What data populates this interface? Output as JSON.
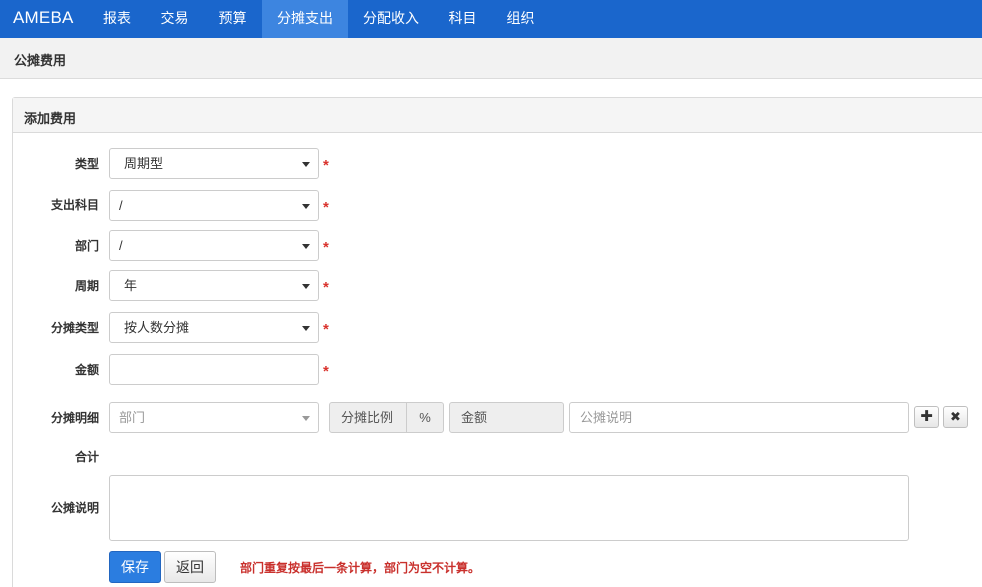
{
  "nav": {
    "brand": "AMEBA",
    "items": [
      {
        "label": "报表"
      },
      {
        "label": "交易"
      },
      {
        "label": "预算"
      },
      {
        "label": "分摊支出",
        "active": true
      },
      {
        "label": "分配收入"
      },
      {
        "label": "科目"
      },
      {
        "label": "组织"
      }
    ]
  },
  "subheader": {
    "title": "公摊费用"
  },
  "panel": {
    "title": "添加费用"
  },
  "form": {
    "type": {
      "label": "类型",
      "value": "周期型"
    },
    "account": {
      "label": "支出科目",
      "value": "/"
    },
    "department": {
      "label": "部门",
      "value": "/"
    },
    "period": {
      "label": "周期",
      "value": "年"
    },
    "allocation_type": {
      "label": "分摊类型",
      "value": "按人数分摊"
    },
    "amount": {
      "label": "金额",
      "value": ""
    },
    "detail": {
      "label": "分摊明细",
      "dept_placeholder": "部门",
      "ratio_placeholder": "分摊比例",
      "percent_addon": "%",
      "amount_placeholder": "金额",
      "desc_placeholder": "公摊说明",
      "add_icon": "plus-icon",
      "remove_icon": "close-icon"
    },
    "total": {
      "label": "合计"
    },
    "description": {
      "label": "公摊说明",
      "value": ""
    },
    "required_mark": "*"
  },
  "actions": {
    "save_label": "保存",
    "back_label": "返回",
    "note": "部门重复按最后一条计算，部门为空不计算。"
  },
  "colors": {
    "navbar": "#1a66cc",
    "active_tab": "#3d85e0",
    "primary": "#2b7de0",
    "required": "#d9322c"
  }
}
